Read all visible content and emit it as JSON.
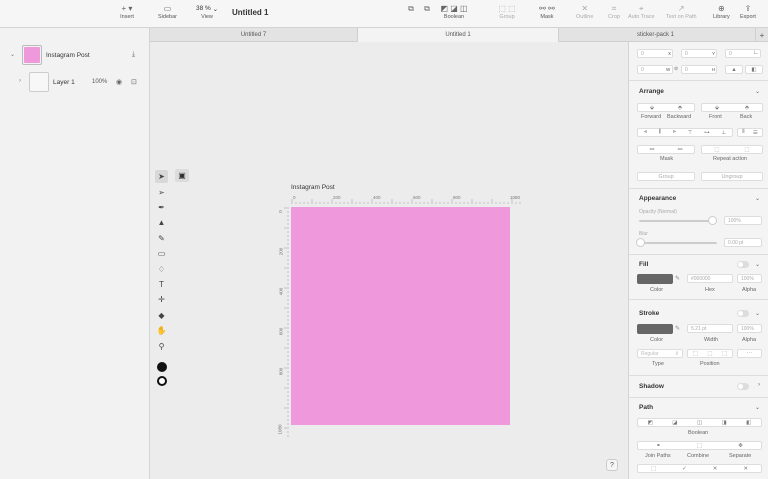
{
  "toolbar": {
    "insert": "Insert",
    "sidebar": "Sidebar",
    "zoom": "38 %",
    "view": "View",
    "doc_title": "Untitled 1",
    "boolean": "Boolean",
    "group": "Group",
    "mask": "Mask",
    "outline": "Outline",
    "crop": "Crop",
    "auto_trace": "Auto Trace",
    "text_on_path": "Text on Path",
    "library": "Library",
    "export": "Export"
  },
  "tabs": [
    "Untitled 7",
    "Untitled 1",
    "sticker-pack 1"
  ],
  "layers": {
    "artboard_name": "Instagram Post",
    "artboard_color": "#ef98dc",
    "layer_name": "Layer 1",
    "layer_opacity": "100%"
  },
  "canvas": {
    "artboard_label": "Instagram Post",
    "ruler_top": [
      "0",
      "200",
      "400",
      "600",
      "800",
      "1080"
    ],
    "ruler_left": [
      "0",
      "200",
      "400",
      "600",
      "800",
      "1080"
    ]
  },
  "tools": [
    "pointer-tool",
    "direct-select-tool",
    "pen-tool",
    "vector-tool",
    "brush-tool",
    "shape-tool",
    "fill-tool",
    "text-tool",
    "transform-tool",
    "eraser-tool",
    "hand-tool",
    "zoom-tool"
  ],
  "inspector": {
    "x_val": "0",
    "x_label": "X",
    "y_val": "0",
    "y_label": "Y",
    "w_val": "0",
    "w_label": "W",
    "h_val": "0",
    "h_label": "H",
    "angle_val": "0",
    "arrange_title": "Arrange",
    "forward": "Forward",
    "backward": "Backward",
    "front": "Front",
    "back": "Back",
    "mask_label": "Mask",
    "repeat_action": "Repeat action",
    "group_btn": "Group",
    "ungroup_btn": "Ungroup",
    "appearance_title": "Appearance",
    "opacity_label": "Opacity (Normal)",
    "opacity_val": "100%",
    "blur_label": "Blur",
    "blur_val": "0.00 pt",
    "fill_title": "Fill",
    "fill_hex": "#000000",
    "fill_alpha": "100%",
    "color_label": "Color",
    "hex_label": "Hex",
    "alpha_label": "Alpha",
    "stroke_title": "Stroke",
    "stroke_width": "5.21 pt",
    "stroke_alpha": "100%",
    "width_label": "Width",
    "type_val": "Regular",
    "type_label": "Type",
    "position_label": "Position",
    "shadow_title": "Shadow",
    "path_title": "Path",
    "boolean_label": "Boolean",
    "join_paths": "Join Paths",
    "combine": "Combine",
    "separate": "Separate"
  },
  "help": "?"
}
